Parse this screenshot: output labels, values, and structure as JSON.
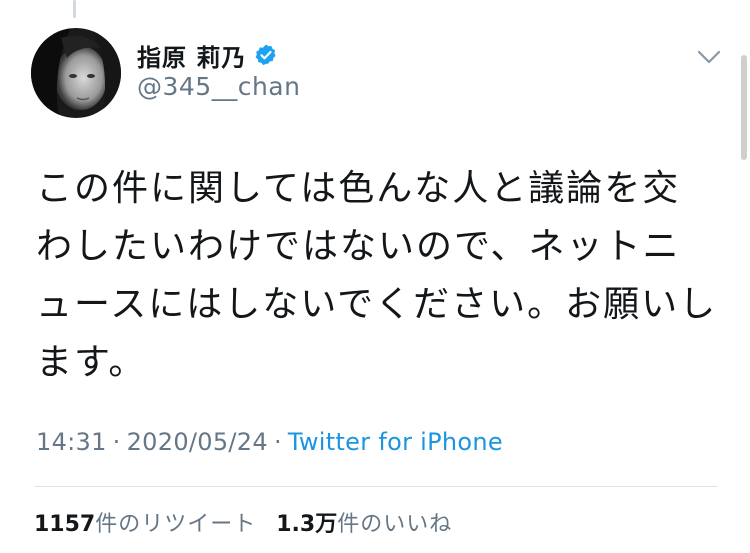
{
  "tweet": {
    "author": {
      "display_name": "指原 莉乃",
      "handle": "@345__chan",
      "verified": true,
      "avatar_icon": "avatar-photo"
    },
    "text": "この件に関しては色んな人と議論を交わしたいわけではないので、ネットニュースにはしないでください。お願いします。",
    "time": "14:31",
    "date": "2020/05/24",
    "separator": "·",
    "source": "Twitter for iPhone",
    "stats": {
      "retweets_count": "1157",
      "retweets_label": "件のリツイート",
      "likes_count": "1.3万",
      "likes_label": "件のいいね"
    }
  },
  "icons": {
    "verified": "verified-badge-icon",
    "caret": "chevron-down-icon"
  },
  "colors": {
    "text": "#14171a",
    "secondary": "#657786",
    "link": "#1b95e0",
    "verified": "#1da1f2"
  }
}
